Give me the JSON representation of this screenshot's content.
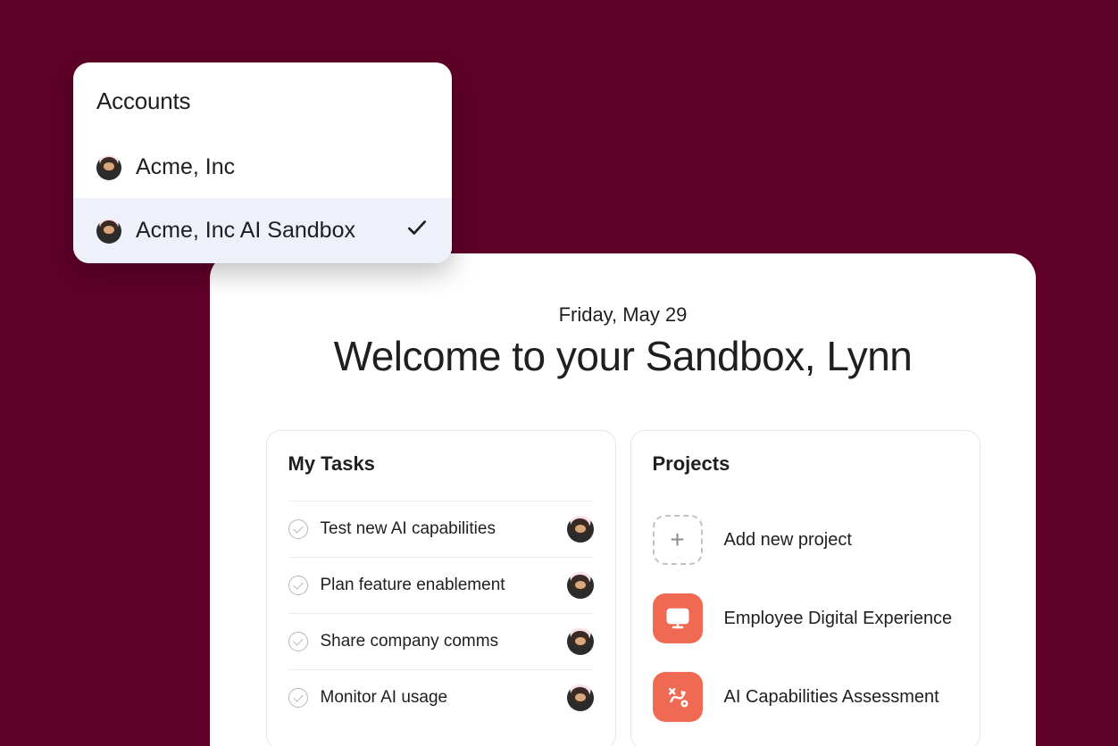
{
  "accounts": {
    "heading": "Accounts",
    "items": [
      {
        "label": "Acme, Inc",
        "selected": false
      },
      {
        "label": "Acme, Inc AI Sandbox",
        "selected": true
      }
    ]
  },
  "dashboard": {
    "date": "Friday, May 29",
    "welcome": "Welcome to your Sandbox, Lynn"
  },
  "tasks": {
    "heading": "My Tasks",
    "items": [
      {
        "label": "Test new AI capabilities"
      },
      {
        "label": "Plan feature enablement"
      },
      {
        "label": "Share company comms"
      },
      {
        "label": "Monitor AI usage"
      }
    ]
  },
  "projects": {
    "heading": "Projects",
    "add_label": "Add new project",
    "items": [
      {
        "label": "Employee Digital Experience",
        "icon": "monitor"
      },
      {
        "label": "AI Capabilities Assessment",
        "icon": "path"
      }
    ]
  }
}
